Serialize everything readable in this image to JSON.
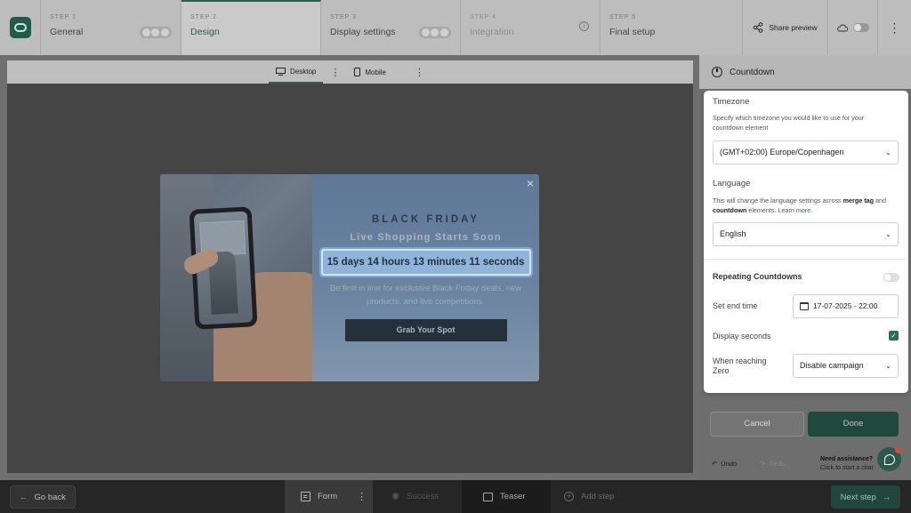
{
  "header": {
    "steps": [
      {
        "label": "STEP 1",
        "name": "General"
      },
      {
        "label": "STEP 2",
        "name": "Design"
      },
      {
        "label": "STEP 3",
        "name": "Display settings"
      },
      {
        "label": "STEP 4",
        "name": "Integration"
      },
      {
        "label": "STEP 5",
        "name": "Final setup"
      }
    ],
    "share_label": "Share preview"
  },
  "device_bar": {
    "desktop_label": "Desktop",
    "mobile_label": "Mobile"
  },
  "popup": {
    "title": "BLACK FRIDAY",
    "subtitle": "Live Shopping Starts Soon",
    "countdown": "15 days 14 hours 13 minutes 11 seconds",
    "description": "Be first in line for exclusive Black Friday deals, new products, and live competitions.",
    "cta": "Grab Your Spot",
    "close": "×"
  },
  "panel": {
    "title": "Countdown",
    "timezone": {
      "title": "Timezone",
      "desc": "Specify which timezone you would like to use for your countdown element",
      "value": "(GMT+02:00) Europe/Copenhagen"
    },
    "language": {
      "title": "Language",
      "desc_1": "This will change the language settings across ",
      "desc_merge": "merge tag",
      "desc_2": " and ",
      "desc_countdown": "countdown",
      "desc_3": " elements. ",
      "desc_link": "Learn more.",
      "value": "English"
    },
    "repeating_label": "Repeating Countdowns",
    "end_time_label": "Set end time",
    "end_time_value": "17-07-2025 - 22:00",
    "display_seconds_label": "Display seconds",
    "reaching_zero_label": "When reaching Zero",
    "reaching_zero_value": "Disable campaign",
    "cancel": "Cancel",
    "done": "Done",
    "undo": "Undo",
    "redo": "Redo",
    "assist_title": "Need assistance?",
    "assist_sub": "Click to start a chat"
  },
  "bottom": {
    "go_back": "Go back",
    "form": "Form",
    "success": "Success",
    "teaser": "Teaser",
    "add_step": "Add step",
    "next_step": "Next step"
  }
}
